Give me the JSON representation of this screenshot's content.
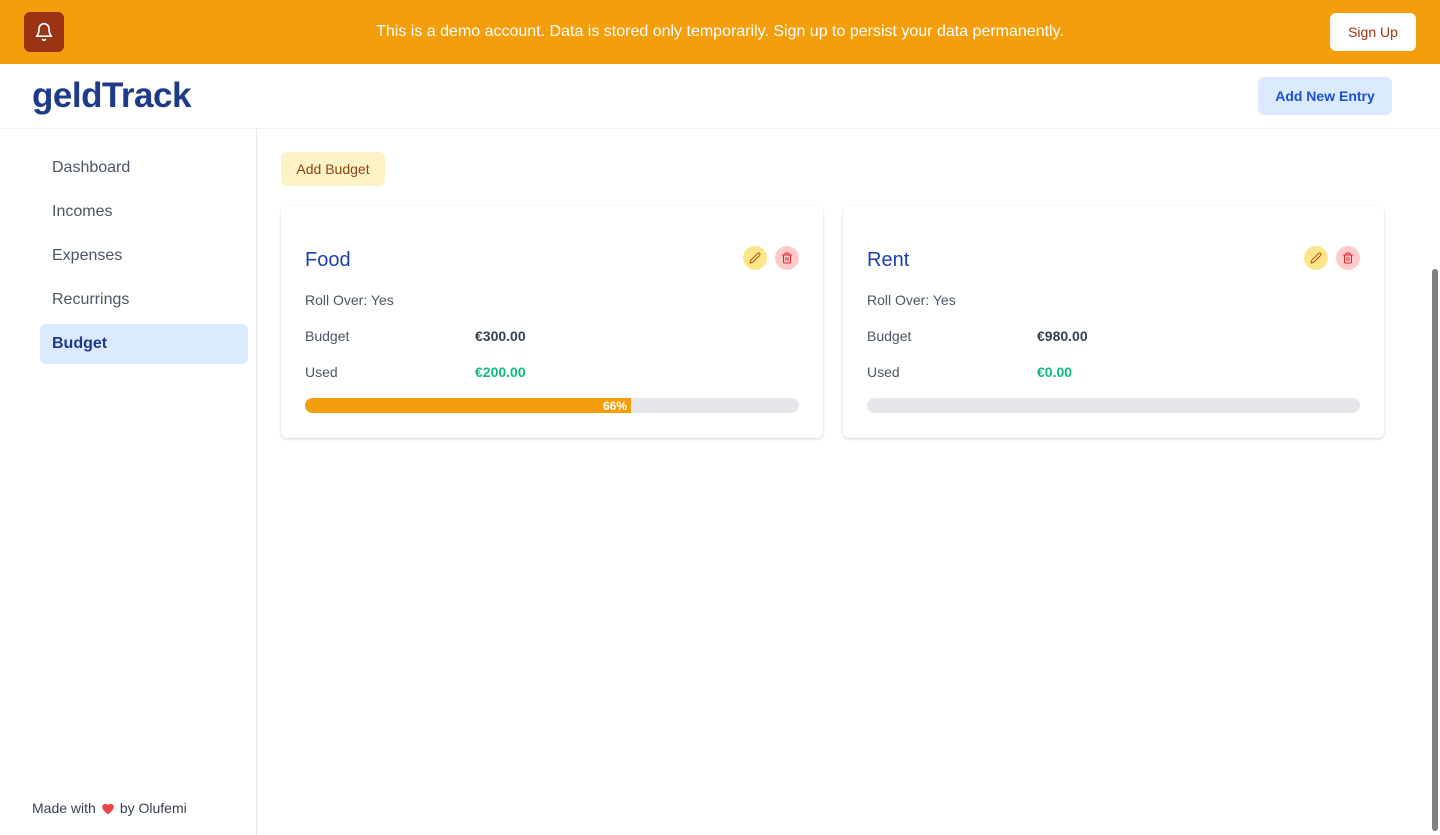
{
  "banner": {
    "message": "This is a demo account. Data is stored only temporarily. Sign up to persist your data permanently.",
    "signup_label": "Sign Up",
    "icon": "bell-icon",
    "color": "#f59e0b"
  },
  "header": {
    "logo": "geldTrack",
    "add_entry_label": "Add New Entry"
  },
  "sidebar": {
    "items": [
      {
        "label": "Dashboard",
        "active": false
      },
      {
        "label": "Incomes",
        "active": false
      },
      {
        "label": "Expenses",
        "active": false
      },
      {
        "label": "Recurrings",
        "active": false
      },
      {
        "label": "Budget",
        "active": true
      }
    ],
    "footer": {
      "prefix": "Made with",
      "icon": "heart-icon",
      "suffix": "by Olufemi"
    }
  },
  "main": {
    "add_budget_label": "Add Budget",
    "cards": [
      {
        "title": "Food",
        "rollover": "Roll Over: Yes",
        "budget_label": "Budget",
        "budget_value": "€300.00",
        "used_label": "Used",
        "used_value": "€200.00",
        "progress": 0.66,
        "progress_label": "66%"
      },
      {
        "title": "Rent",
        "rollover": "Roll Over: Yes",
        "budget_label": "Budget",
        "budget_value": "€980.00",
        "used_label": "Used",
        "used_value": "€0.00",
        "progress": 0,
        "progress_label": ""
      }
    ]
  },
  "colors": {
    "accent": "#f59e0b",
    "brand": "#1e3a8a",
    "used_value": "#10b981"
  }
}
